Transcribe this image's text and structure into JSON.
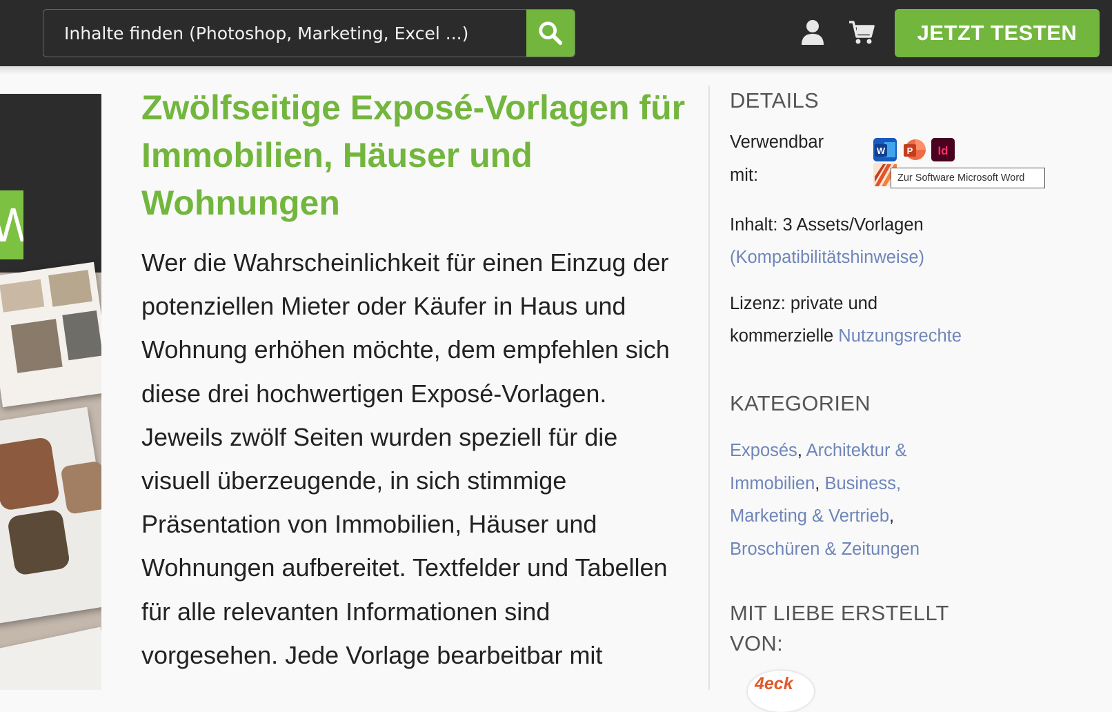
{
  "search": {
    "placeholder": "Inhalte finden (Photoshop, Marketing, Excel ...)"
  },
  "header": {
    "cta_label": "JETZT TESTEN"
  },
  "product": {
    "title": "Zwölfseitige Exposé-Vorlagen für Immobilien, Häuser und Wohnungen",
    "description": "Wer die Wahrscheinlichkeit für einen Einzug der potenziellen Mieter oder Käufer in Haus und Wohnung erhöhen möchte, dem empfehlen sich diese drei hochwertigen Exposé-Vorlagen. Jeweils zwölf Seiten wurden speziell für die visuell überzeugende, in sich stimmige Präsentation von Immobilien, Häuser und Wohnungen aufbereitet. Textfelder und Tabellen für alle relevanten Informationen sind vorgesehen. Jede Vorlage bearbeitbar mit"
  },
  "details": {
    "heading": "DETAILS",
    "usable_label_1": "Verwendbar",
    "usable_label_2": "mit:",
    "apps": [
      {
        "icon": "word-icon",
        "letter": "W",
        "color": "#185abd"
      },
      {
        "icon": "powerpoint-icon",
        "letter": "P",
        "color": "#d24726"
      },
      {
        "icon": "indesign-icon",
        "letter": "Id",
        "color": "#4a0a24"
      },
      {
        "icon": "affinity-publisher-icon",
        "letter": "",
        "color": "#d9572b"
      }
    ],
    "tooltip": "Zur Software Microsoft Word",
    "content_label": "Inhalt: 3 Assets/Vorlagen",
    "compat_link": "(Kompatibilitätshinweise)",
    "license_line_1": "Lizenz: private und",
    "license_line_2": "kommerzielle",
    "license_link": "Nutzungsrechte"
  },
  "categories": {
    "heading": "KATEGORIEN",
    "items": [
      "Exposés",
      "Architektur & Immobilien",
      "Business, Marketing & Vertrieb",
      "Broschüren & Zeitungen"
    ]
  },
  "author": {
    "heading_1": "MIT LIEBE ERSTELLT",
    "heading_2": "VON:",
    "logo_text": "4eck"
  },
  "preview": {
    "side_letter": "W"
  },
  "colors": {
    "accent": "#73b63e",
    "link": "#6f86b9",
    "topbar": "#2b2b2b"
  }
}
